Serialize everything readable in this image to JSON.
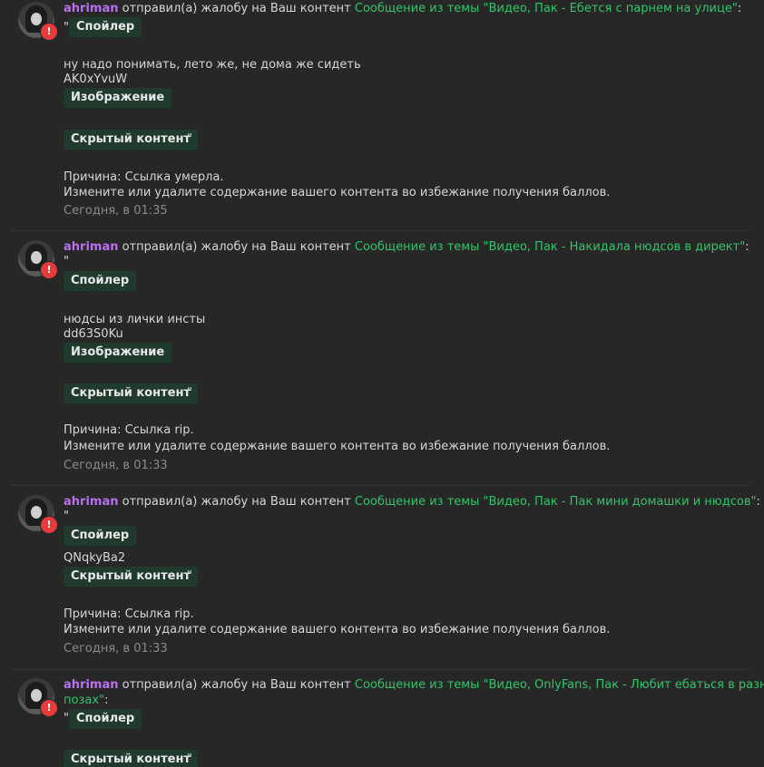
{
  "common": {
    "reported_text": "отправил(а) жалобу на Ваш контент",
    "spoiler_label": "Спойлер",
    "image_label": "Изображение",
    "hidden_label": "Скрытый контент",
    "quote": "\"",
    "colon": ":",
    "instruction": "Измените или удалите содержание вашего контента во избежание получения баллов."
  },
  "alerts": [
    {
      "user": "ahriman",
      "topic": "Сообщение из темы \"Видео, Пак - Ебется с парнем на улице\"",
      "body_text": "ну надо понимать, лето же, не дома же сидеть",
      "code": "AK0xYvuW",
      "reason": "Причина: Ссылка умерла.",
      "time": "Сегодня, в 01:35"
    },
    {
      "user": "ahriman",
      "topic": "Сообщение из темы \"Видео, Пак - Накидала нюдсов в директ\"",
      "body_text": "нюдсы из лички инсты",
      "code": "dd63S0Ku",
      "reason": "Причина: Ссылка rip.",
      "time": "Сегодня, в 01:33"
    },
    {
      "user": "ahriman",
      "topic": "Сообщение из темы \"Видео, Пак - Пак мини домашки и нюдсов\"",
      "code": "QNqkyBa2",
      "reason": "Причина: Ссылка rip.",
      "time": "Сегодня, в 01:33"
    },
    {
      "user": "ahriman",
      "topic_line1": "Сообщение из темы \"Видео, OnlyFans, Пак - Любит ебаться в разных",
      "topic_line2": "позах\""
    }
  ]
}
